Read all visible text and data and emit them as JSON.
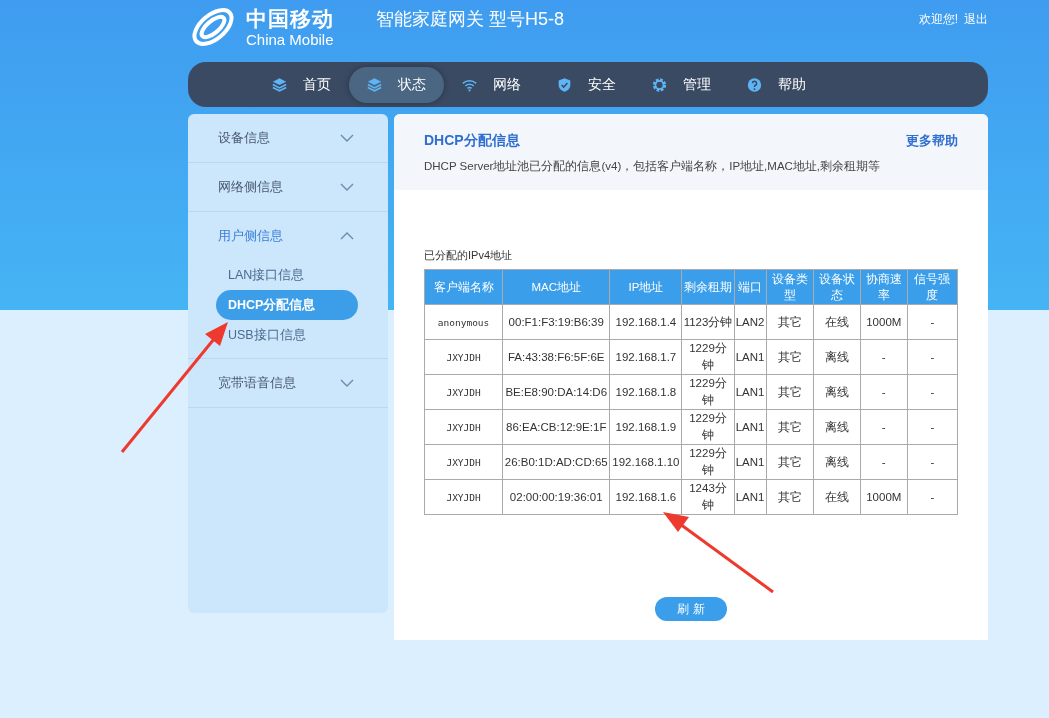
{
  "header": {
    "logo_cn": "中国移动",
    "logo_en": "China Mobile",
    "title": "智能家庭网关 型号H5-8",
    "welcome": "欢迎您!",
    "logout": "退出"
  },
  "nav": [
    {
      "label": "首页",
      "kind": "layers",
      "selected": false
    },
    {
      "label": "状态",
      "kind": "layers",
      "selected": true
    },
    {
      "label": "网络",
      "kind": "wifi",
      "selected": false
    },
    {
      "label": "安全",
      "kind": "shield",
      "selected": false
    },
    {
      "label": "管理",
      "kind": "gear",
      "selected": false
    },
    {
      "label": "帮助",
      "kind": "help",
      "selected": false
    }
  ],
  "sidebar": [
    {
      "label": "设备信息",
      "expanded": false
    },
    {
      "label": "网络侧信息",
      "expanded": false
    },
    {
      "label": "用户侧信息",
      "expanded": true,
      "children": [
        {
          "label": "LAN接口信息",
          "selected": false
        },
        {
          "label": "DHCP分配信息",
          "selected": true
        },
        {
          "label": "USB接口信息",
          "selected": false
        }
      ]
    },
    {
      "label": "宽带语音信息",
      "expanded": false
    }
  ],
  "content": {
    "title": "DHCP分配信息",
    "help_link": "更多帮助",
    "description": "DHCP Server地址池已分配的信息(v4)，包括客户端名称，IP地址,MAC地址,剩余租期等",
    "table_caption": "已分配的IPv4地址",
    "table": {
      "columns": [
        "客户端名称",
        "MAC地址",
        "IP地址",
        "剩余租期",
        "端口",
        "设备类型",
        "设备状态",
        "协商速率",
        "信号强度"
      ],
      "rows": [
        [
          "anonymous",
          "00:F1:F3:19:B6:39",
          "192.168.1.4",
          "1123分钟",
          "LAN2",
          "其它",
          "在线",
          "1000M",
          "-"
        ],
        [
          "JXYJDH",
          "FA:43:38:F6:5F:6E",
          "192.168.1.7",
          "1229分钟",
          "LAN1",
          "其它",
          "离线",
          "-",
          "-"
        ],
        [
          "JXYJDH",
          "BE:E8:90:DA:14:D6",
          "192.168.1.8",
          "1229分钟",
          "LAN1",
          "其它",
          "离线",
          "-",
          "-"
        ],
        [
          "JXYJDH",
          "86:EA:CB:12:9E:1F",
          "192.168.1.9",
          "1229分钟",
          "LAN1",
          "其它",
          "离线",
          "-",
          "-"
        ],
        [
          "JXYJDH",
          "26:B0:1D:AD:CD:65",
          "192.168.1.10",
          "1229分钟",
          "LAN1",
          "其它",
          "离线",
          "-",
          "-"
        ],
        [
          "JXYJDH",
          "02:00:00:19:36:01",
          "192.168.1.6",
          "1243分钟",
          "LAN1",
          "其它",
          "在线",
          "1000M",
          "-"
        ]
      ]
    },
    "refresh_button": "刷 新"
  }
}
